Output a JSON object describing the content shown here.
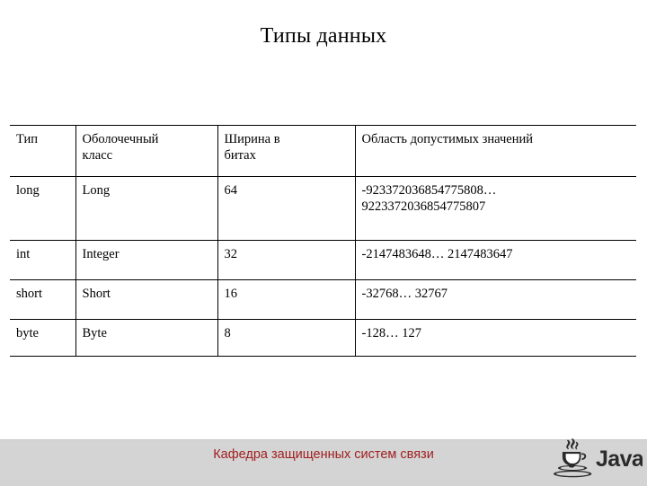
{
  "slide": {
    "title": "Типы данных",
    "background_color": "#ffffff"
  },
  "table": {
    "headers": [
      "Тип",
      "Оболочечный класс",
      "Ширина в битах",
      "Область допустимых значений"
    ],
    "header_lines": {
      "col1": [
        "Тип"
      ],
      "col2": [
        "Оболочечный",
        "класс"
      ],
      "col3": [
        "Ширина в",
        "битах"
      ],
      "col4": [
        "Область допустимых значений"
      ]
    },
    "rows": [
      {
        "type": "long",
        "wrapper_class": "Long",
        "width_bits": "64",
        "range_lines": [
          "-923372036854775808…",
          "9223372036854775807"
        ]
      },
      {
        "type": "int",
        "wrapper_class": "Integer",
        "width_bits": "32",
        "range_lines": [
          "-2147483648… 2147483647"
        ]
      },
      {
        "type": "short",
        "wrapper_class": "Short",
        "width_bits": "16",
        "range_lines": [
          "-32768… 32767"
        ]
      },
      {
        "type": "byte",
        "wrapper_class": "Byte",
        "width_bits": "8",
        "range_lines": [
          "-128… 127"
        ]
      }
    ]
  },
  "footer": {
    "text": "Кафедра защищенных систем связи",
    "text_color": "#a01f1f",
    "bar_color": "#d4d4d4",
    "logo_label": "Java",
    "logo_icon": "java-coffee-cup-icon"
  }
}
